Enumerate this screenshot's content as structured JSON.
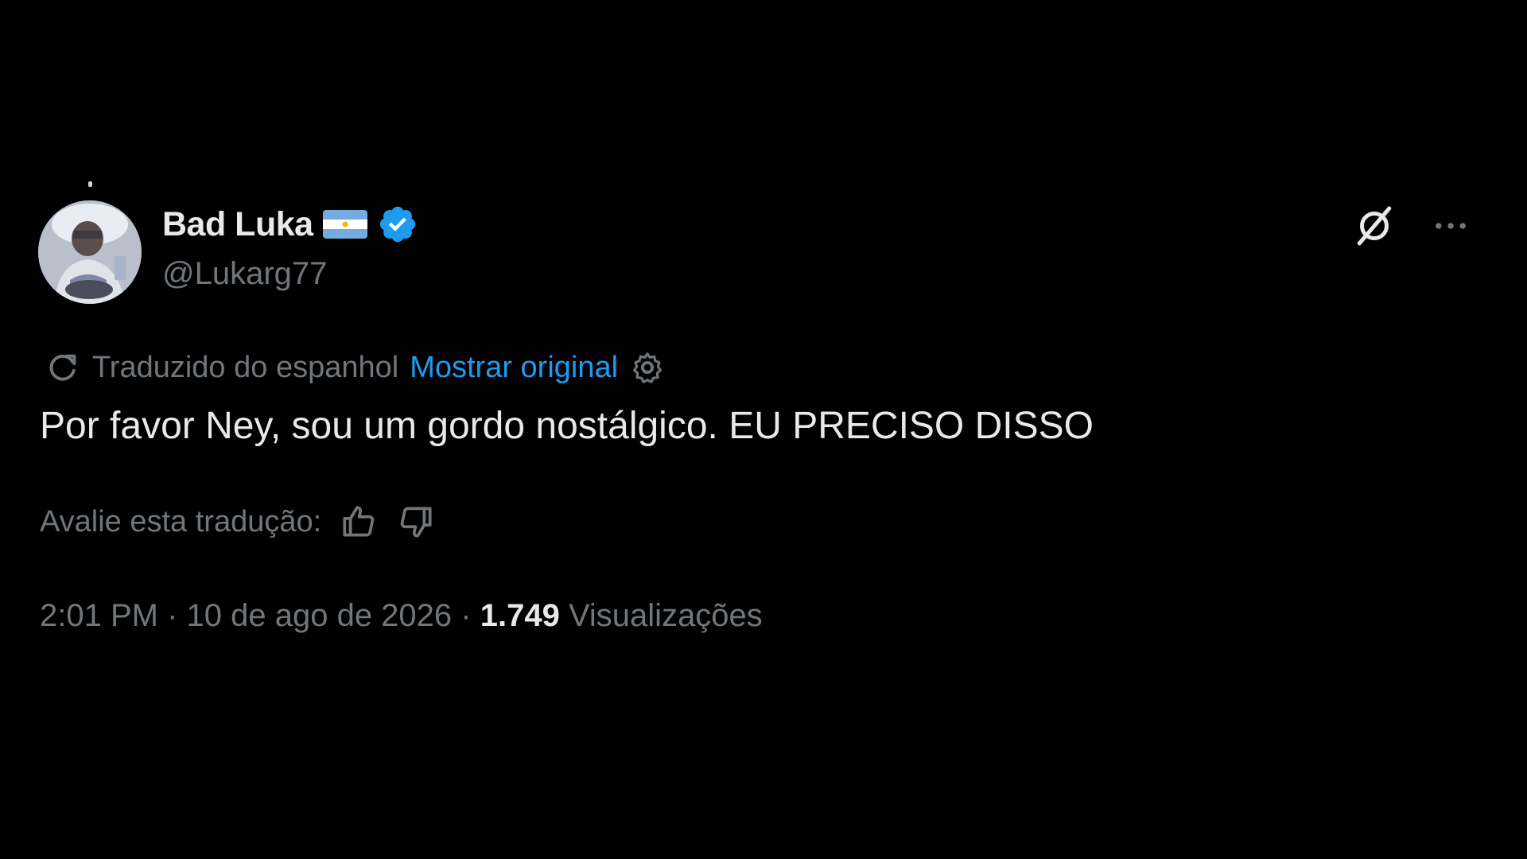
{
  "author": {
    "display_name": "Bad Luka",
    "handle": "@Lukarg77",
    "flag_icon": "argentina-flag-icon",
    "verified_icon": "verified-badge-icon",
    "verified_color": "#1d9bf0"
  },
  "actions": {
    "grok_icon": "grok-icon",
    "more_icon": "more-icon"
  },
  "translation": {
    "icon": "translate-icon",
    "translated_from": "Traduzido do espanhol",
    "show_original": "Mostrar original",
    "settings_icon": "gear-icon"
  },
  "tweet": {
    "text": "Por favor Ney, sou um gordo nostálgico. EU PRECISO DISSO"
  },
  "rating": {
    "label": "Avalie esta tradução:",
    "thumbs_up_icon": "thumbs-up-icon",
    "thumbs_down_icon": "thumbs-down-icon"
  },
  "meta": {
    "time": "2:01 PM",
    "separator": " · ",
    "date": "10 de ago de 2026",
    "views_count": "1.749",
    "views_label": "Visualizações"
  },
  "colors": {
    "background": "#000000",
    "primary_text": "#e7e9ea",
    "secondary_text": "#71767b",
    "link": "#1d9bf0"
  }
}
